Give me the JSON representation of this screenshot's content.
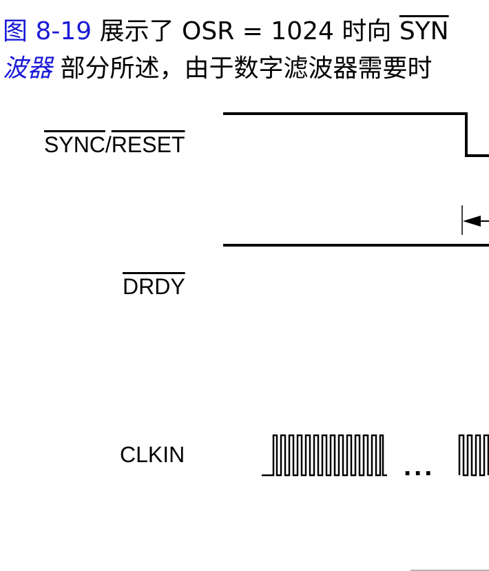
{
  "text": {
    "line1": {
      "figure_ref": "图 8-19",
      "middle": " 展示了 OSR = 1024 时向 ",
      "sync_overline": "SYN"
    },
    "line2": {
      "section_ref": "波器",
      "rest": " 部分所述，由于数字滤波器需要时"
    }
  },
  "diagram": {
    "signals": {
      "sync_part": "SYNC",
      "slash": "/",
      "reset_part": "RESET",
      "drdy": "DRDY",
      "clkin": "CLKIN"
    },
    "ellipsis": "..."
  }
}
